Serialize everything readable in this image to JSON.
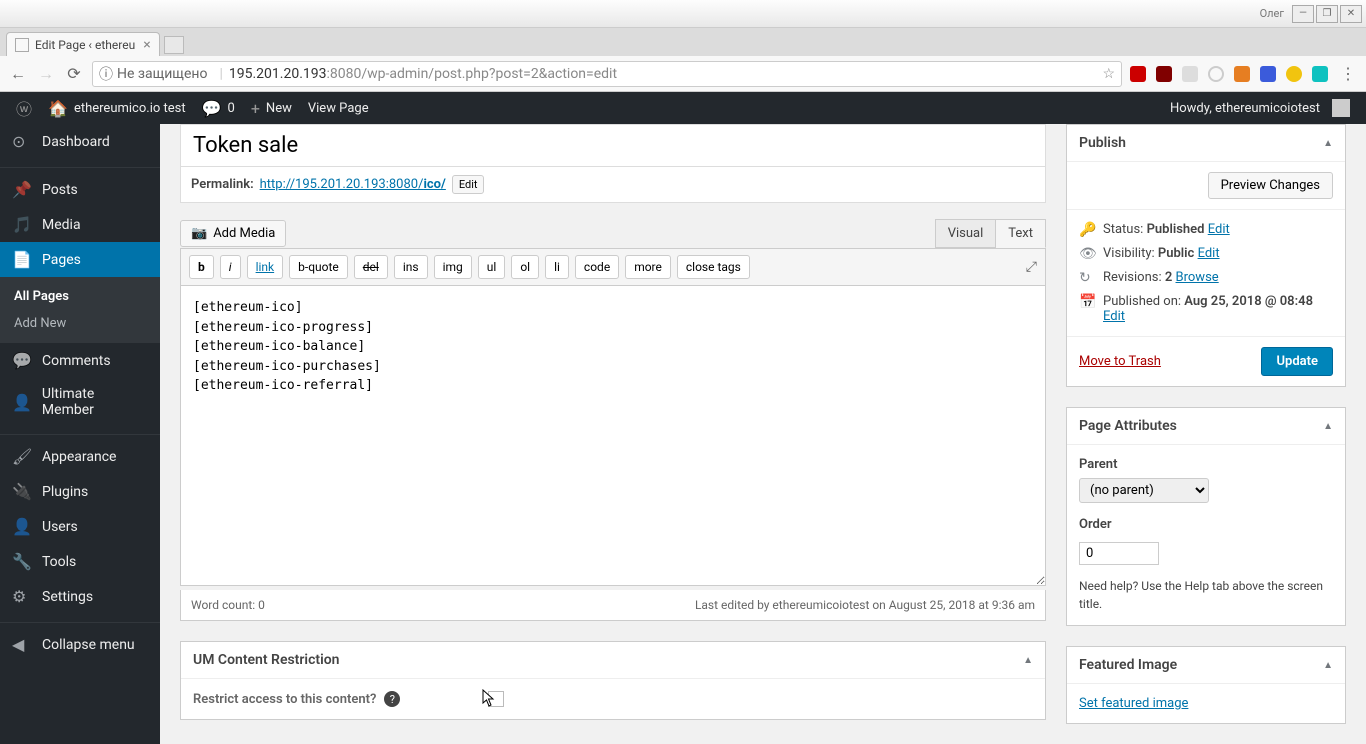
{
  "window": {
    "user": "Олег",
    "tab_title": "Edit Page ‹ ethereu"
  },
  "browser": {
    "insecure_label": "Не защищено",
    "url_host": "195.201.20.193",
    "url_port": ":8080",
    "url_path": "/wp-admin/post.php?post=2&action=edit"
  },
  "adminbar": {
    "site_name": "ethereumico.io test",
    "comments_count": "0",
    "new_label": "New",
    "view_page": "View Page",
    "howdy": "Howdy, ethereumicoiotest"
  },
  "menu": {
    "dashboard": "Dashboard",
    "posts": "Posts",
    "media": "Media",
    "pages": "Pages",
    "all_pages": "All Pages",
    "add_new": "Add New",
    "comments": "Comments",
    "ultimate_member": "Ultimate Member",
    "appearance": "Appearance",
    "plugins": "Plugins",
    "users": "Users",
    "tools": "Tools",
    "settings": "Settings",
    "collapse": "Collapse menu"
  },
  "editor": {
    "title": "Token sale",
    "permalink_label": "Permalink:",
    "permalink_base": "http://195.201.20.193:8080/",
    "permalink_slug": "ico/",
    "edit_btn": "Edit",
    "add_media": "Add Media",
    "tab_visual": "Visual",
    "tab_text": "Text",
    "qt": {
      "b": "b",
      "i": "i",
      "link": "link",
      "bquote": "b-quote",
      "del": "del",
      "ins": "ins",
      "img": "img",
      "ul": "ul",
      "ol": "ol",
      "li": "li",
      "code": "code",
      "more": "more",
      "close": "close tags"
    },
    "content": "[ethereum-ico]\n[ethereum-ico-progress]\n[ethereum-ico-balance]\n[ethereum-ico-purchases]\n[ethereum-ico-referral]",
    "word_count": "Word count: 0",
    "last_edited": "Last edited by ethereumicoiotest on August 25, 2018 at 9:36 am"
  },
  "um": {
    "box_title": "UM Content Restriction",
    "restrict_label": "Restrict access to this content?"
  },
  "publish": {
    "box_title": "Publish",
    "preview": "Preview Changes",
    "status_label": "Status:",
    "status_value": "Published",
    "status_edit": "Edit",
    "visibility_label": "Visibility:",
    "visibility_value": "Public",
    "visibility_edit": "Edit",
    "revisions_label": "Revisions:",
    "revisions_count": "2",
    "revisions_browse": "Browse",
    "published_label": "Published on:",
    "published_value": "Aug 25, 2018 @ 08:48",
    "published_edit": "Edit",
    "trash": "Move to Trash",
    "update": "Update"
  },
  "attributes": {
    "box_title": "Page Attributes",
    "parent_label": "Parent",
    "parent_value": "(no parent)",
    "order_label": "Order",
    "order_value": "0",
    "help": "Need help? Use the Help tab above the screen title."
  },
  "featured": {
    "box_title": "Featured Image",
    "link": "Set featured image"
  }
}
